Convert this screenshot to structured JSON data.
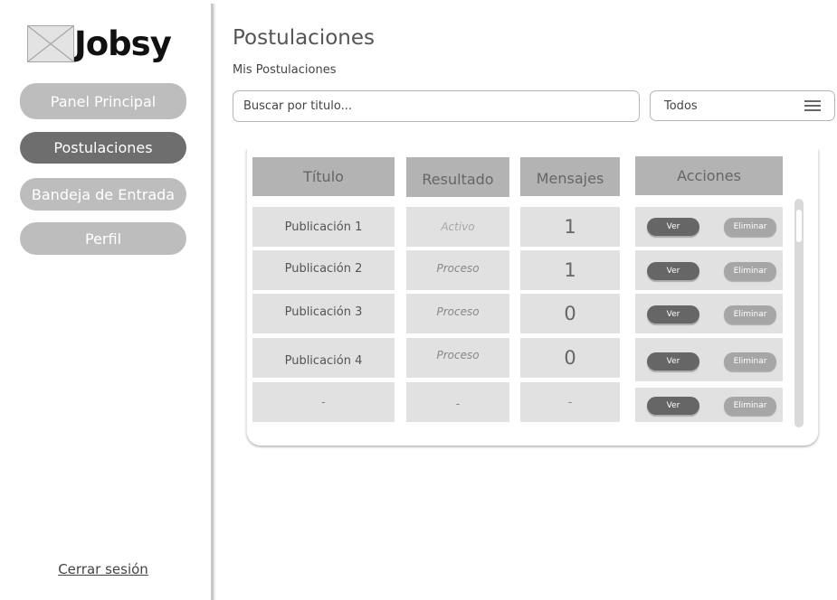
{
  "sidebar": {
    "logo_text": "Jobsy",
    "nav": [
      {
        "label": "Panel Principal"
      },
      {
        "label": "Postulaciones"
      },
      {
        "label": "Bandeja de Entrada"
      },
      {
        "label": "Perfil"
      }
    ],
    "logout": "Cerrar sesión"
  },
  "main": {
    "title": "Postulaciones",
    "subtitle": "Mis Postulaciones",
    "search": {
      "placeholder": "Buscar por titulo..."
    },
    "filter": {
      "value": "Todos"
    }
  },
  "table": {
    "headers": [
      "Título",
      "Resultado",
      "Mensajes",
      "Acciones"
    ],
    "rows": [
      {
        "titulo": "Publicación 1",
        "resultado": "Activo",
        "mensajes": "1"
      },
      {
        "titulo": "Publicación 2",
        "resultado": "Proceso",
        "mensajes": "1"
      },
      {
        "titulo": "Publicación 3",
        "resultado": "Proceso",
        "mensajes": "0"
      },
      {
        "titulo": "Publicación 4",
        "resultado": "Proceso",
        "mensajes": "0"
      },
      {
        "titulo": "-",
        "resultado": "-",
        "mensajes": "-"
      }
    ],
    "actions": {
      "view": "Ver",
      "delete": "Eliminar"
    }
  },
  "colors": {
    "active_nav": "#6e6e6e",
    "inactive_nav": "#bdbdbd",
    "header_cell": "#b3b3b3",
    "body_cell": "#e1e1e1",
    "view_button": "#666666",
    "delete_button": "#a6a6a6"
  }
}
